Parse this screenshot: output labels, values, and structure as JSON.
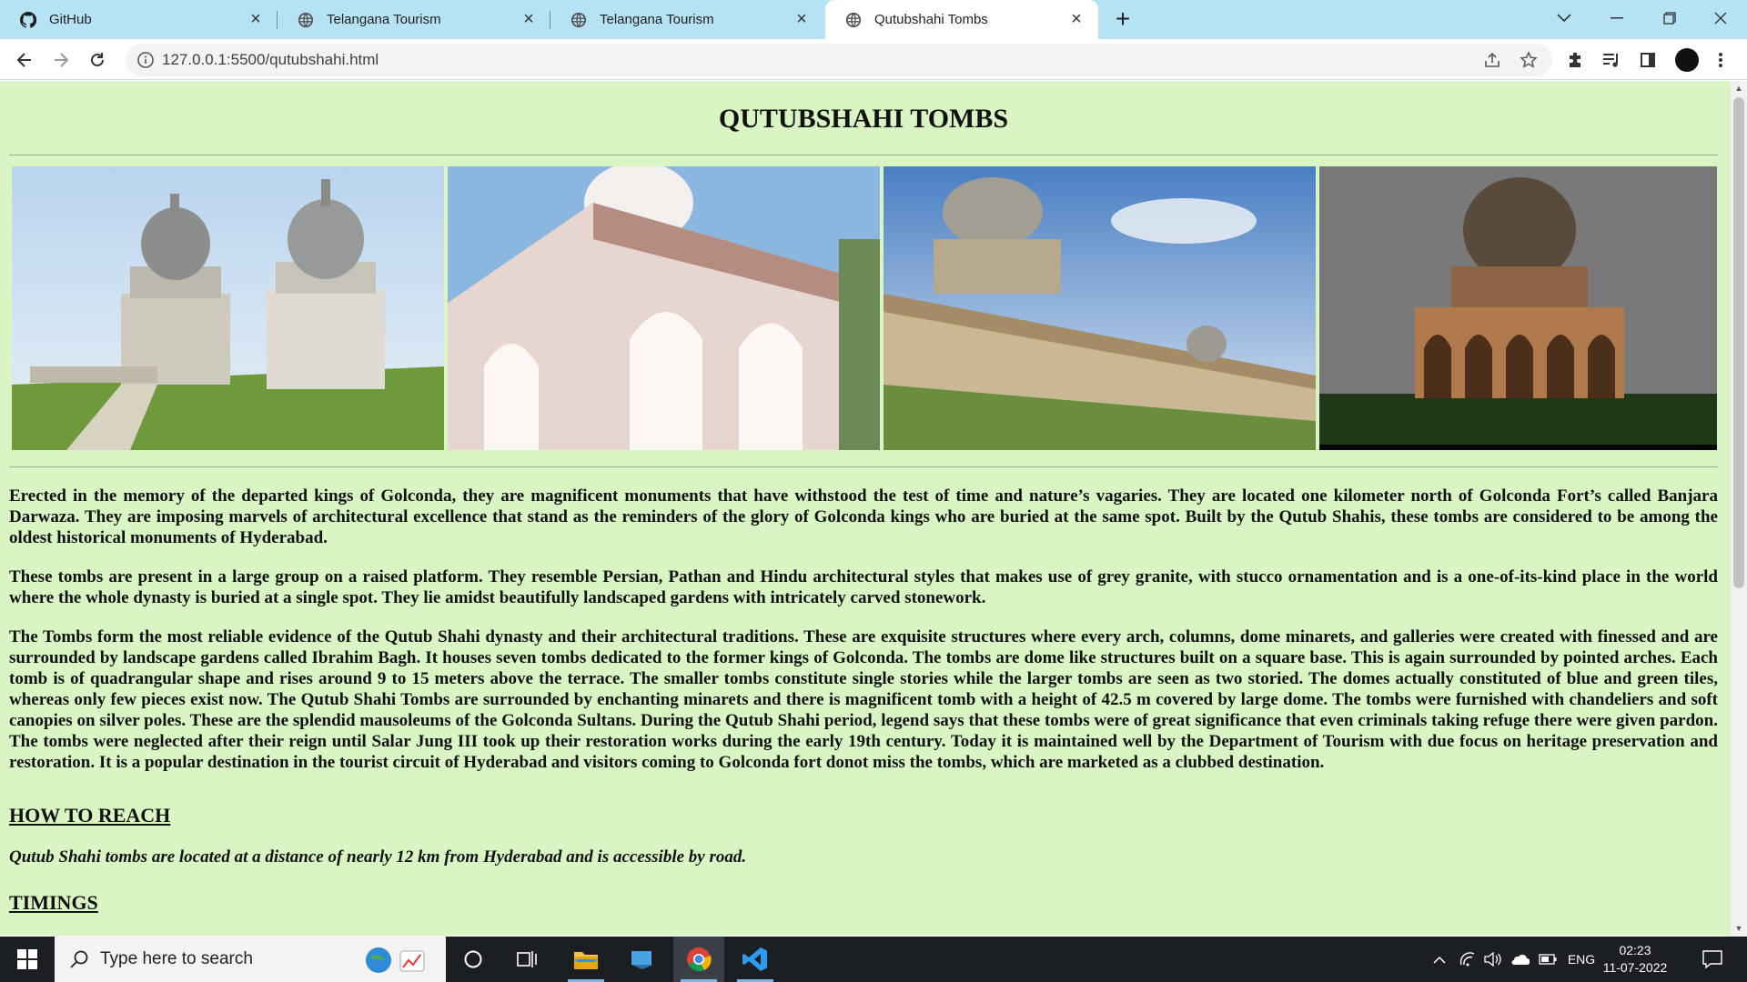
{
  "browser": {
    "tabs": [
      {
        "label": "GitHub",
        "favicon": "github-icon"
      },
      {
        "label": "Telangana Tourism",
        "favicon": "globe-icon"
      },
      {
        "label": "Telangana Tourism",
        "favicon": "globe-icon"
      },
      {
        "label": "Qutubshahi Tombs",
        "favicon": "globe-icon",
        "active": true
      }
    ],
    "url": "127.0.0.1:5500/qutubshahi.html"
  },
  "page": {
    "title": "QUTUBSHAHI TOMBS",
    "background": "#d9f5c4",
    "photos": [
      {
        "icon": "photo-tombs-garden"
      },
      {
        "icon": "photo-tomb-arches"
      },
      {
        "icon": "photo-tomb-gallery"
      },
      {
        "icon": "photo-tomb-hdr"
      }
    ],
    "paragraphs": [
      "Erected in the memory of the departed kings of Golconda, they are magnificent monuments that have withstood the test of time and nature’s vagaries. They are located one kilometer north of Golconda Fort’s called Banjara Darwaza. They are imposing marvels of architectural excellence that stand as the reminders of the glory of Golconda kings who are buried at the same spot. Built by the Qutub Shahis, these tombs are considered to be among the oldest historical monuments of Hyderabad.",
      "These tombs are present in a large group on a raised platform. They resemble Persian, Pathan and Hindu architectural styles that makes use of grey granite, with stucco ornamentation and is a one-of-its-kind place in the world where the whole dynasty is buried at a single spot. They lie amidst beautifully landscaped gardens with intricately carved stonework.",
      "The Tombs form the most reliable evidence of the Qutub Shahi dynasty and their architectural traditions. These are exquisite structures where every arch, columns, dome minarets, and galleries were created with finessed and are surrounded by landscape gardens called Ibrahim Bagh. It houses seven tombs dedicated to the former kings of Golconda. The tombs are dome like structures built on a square base. This is again surrounded by pointed arches. Each tomb is of quadrangular shape and rises around 9 to 15 meters above the terrace. The smaller tombs constitute single stories while the larger tombs are seen as two storied. The domes actually constituted of blue and green tiles, whereas only few pieces exist now. The Qutub Shahi Tombs are surrounded by enchanting minarets and there is magnificent tomb with a height of 42.5 m covered by large dome. The tombs were furnished with chandeliers and soft canopies on silver poles. These are the splendid mausoleums of the Golconda Sultans. During the Qutub Shahi period, legend says that these tombs were of great significance that even criminals taking refuge there were given pardon. The tombs were neglected after their reign until Salar Jung III took up their restoration works during the early 19th century. Today it is maintained well by the Department of Tourism with due focus on heritage preservation and restoration. It is a popular destination in the tourist circuit of Hyderabad and visitors coming to Golconda fort donot miss the tombs, which are marketed as a clubbed destination."
    ],
    "how_to_reach_heading": "HOW TO REACH",
    "how_to_reach_text": "Qutub Shahi tombs are located at a distance of nearly 12 km from Hyderabad and is accessible by road.",
    "timings_heading": "TIMINGS"
  },
  "taskbar": {
    "search_placeholder": "Type here to search",
    "language": "ENG",
    "time": "02:23",
    "date": "11-07-2022"
  }
}
